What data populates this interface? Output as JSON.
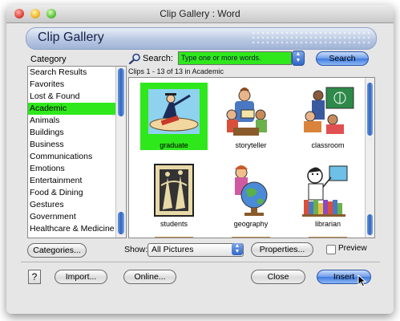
{
  "window": {
    "title": "Clip Gallery : Word"
  },
  "banner": {
    "title": "Clip Gallery"
  },
  "category": {
    "heading": "Category",
    "items": [
      "Search Results",
      "Favorites",
      "Lost & Found",
      "Academic",
      "Animals",
      "Buildings",
      "Business",
      "Communications",
      "Emotions",
      "Entertainment",
      "Food & Dining",
      "Gestures",
      "Government",
      "Healthcare & Medicine"
    ],
    "selected": "Academic"
  },
  "search": {
    "label": "Search:",
    "placeholder": "Type one or more words.",
    "button": "Search"
  },
  "clips": {
    "status": "Clips 1 - 13 of 13 in Academic",
    "items": [
      {
        "caption": "graduate",
        "icon": "graduate-clipart",
        "selected": true
      },
      {
        "caption": "storyteller",
        "icon": "storyteller-clipart",
        "selected": false
      },
      {
        "caption": "classroom",
        "icon": "classroom-clipart",
        "selected": false
      },
      {
        "caption": "students",
        "icon": "students-clipart",
        "selected": false
      },
      {
        "caption": "geography",
        "icon": "geography-clipart",
        "selected": false
      },
      {
        "caption": "librarian",
        "icon": "librarian-clipart",
        "selected": false
      }
    ]
  },
  "controls": {
    "categories": "Categories...",
    "show_label": "Show:",
    "show_value": "All Pictures",
    "properties": "Properties...",
    "preview": "Preview",
    "help": "?",
    "import": "Import...",
    "online": "Online...",
    "close": "Close",
    "insert": "Insert"
  },
  "colors": {
    "selection": "#2fe81c",
    "accent_blue": "#3e7be0"
  }
}
